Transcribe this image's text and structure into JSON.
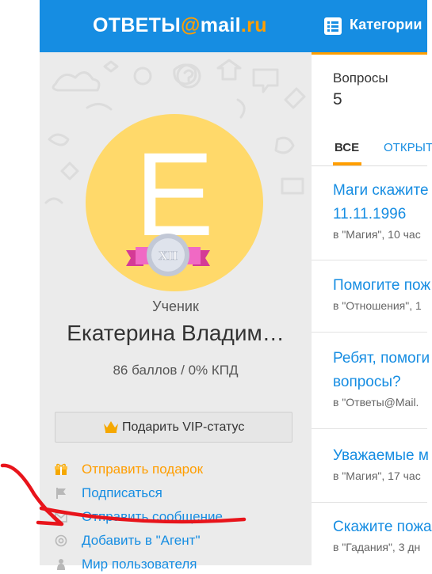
{
  "header": {
    "logo_prefix": "ОТВЕТЫ",
    "logo_at": "@",
    "logo_mail": "mail",
    "logo_dot": ".",
    "logo_ru": "ru",
    "categories_label": "Категории"
  },
  "profile": {
    "avatar_letter": "E",
    "rank_badge": "XII",
    "rank": "Ученик",
    "name": "Екатерина Владим…",
    "score": "86 баллов / 0% КПД",
    "vip_label": "Подарить VIP-статус",
    "actions": [
      {
        "label": "Отправить подарок",
        "icon": "gift-icon"
      },
      {
        "label": "Подписаться",
        "icon": "flag-icon"
      },
      {
        "label": "Отправить сообщение",
        "icon": "envelope-icon"
      },
      {
        "label": "Добавить в \"Агент\"",
        "icon": "at-icon"
      },
      {
        "label": "Мир пользователя",
        "icon": "person-icon"
      }
    ]
  },
  "stats": {
    "questions_label": "Вопросы",
    "questions_count": "5"
  },
  "tabs": {
    "all": "ВСЕ",
    "open": "ОТКРЫТ"
  },
  "questions": [
    {
      "title_1": "Маги скажите",
      "title_2": "11.11.1996",
      "meta": "в \"Магия\", 10 час"
    },
    {
      "title_1": "Помогите пож",
      "title_2": "",
      "meta": "в \"Отношения\", 1"
    },
    {
      "title_1": "Ребят, помоги",
      "title_2": "вопросы?",
      "meta": "в \"Ответы@Mail."
    },
    {
      "title_1": "Уважаемые м",
      "title_2": "",
      "meta": "в \"Магия\", 17 час"
    },
    {
      "title_1": "Скажите пожа",
      "title_2": "",
      "meta": "в \"Гадания\", 3 дн"
    }
  ],
  "colors": {
    "brand_blue": "#168de2",
    "accent_orange": "#ff9e00",
    "avatar_yellow": "#ffd96a",
    "annotation_red": "#e8141b"
  }
}
